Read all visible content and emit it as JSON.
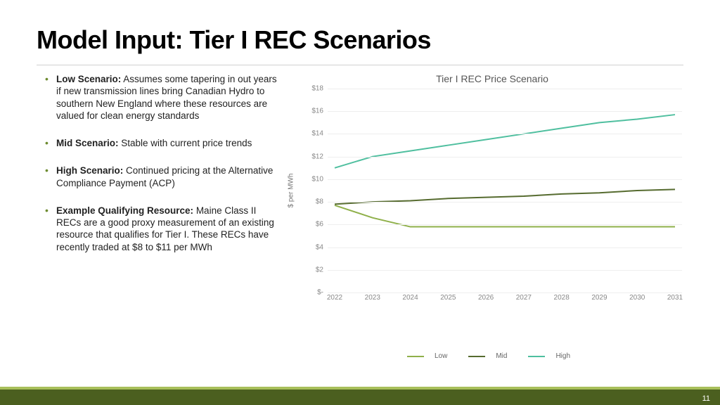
{
  "title": "Model Input: Tier I REC Scenarios",
  "bullets": [
    {
      "bold": "Low Scenario:",
      "rest": " Assumes some tapering in out years if new transmission lines bring Canadian Hydro to southern New England where these resources are valued for clean energy standards"
    },
    {
      "bold": "Mid Scenario:",
      "rest": " Stable with current price trends"
    },
    {
      "bold": "High Scenario:",
      "rest": " Continued pricing at the Alternative Compliance Payment (ACP)"
    },
    {
      "bold": "Example Qualifying Resource:",
      "rest": " Maine Class II RECs are a good proxy measurement of an existing resource that qualifies for Tier I. These RECs have recently traded at $8 to $11 per MWh"
    }
  ],
  "page_number": "11",
  "chart_data": {
    "type": "line",
    "title": "Tier I REC Price Scenario",
    "xlabel": "",
    "ylabel": "$ per MWh",
    "categories": [
      "2022",
      "2023",
      "2024",
      "2025",
      "2026",
      "2027",
      "2028",
      "2029",
      "2030",
      "2031"
    ],
    "yticks": [
      "$-",
      "$2",
      "$4",
      "$6",
      "$8",
      "$10",
      "$12",
      "$14",
      "$16",
      "$18"
    ],
    "ylim": [
      0,
      18
    ],
    "series": [
      {
        "name": "Low",
        "color": "#8fb04a",
        "values": [
          7.7,
          6.6,
          5.8,
          5.8,
          5.8,
          5.8,
          5.8,
          5.8,
          5.8,
          5.8
        ]
      },
      {
        "name": "Mid",
        "color": "#566b2f",
        "values": [
          7.8,
          8.0,
          8.1,
          8.3,
          8.4,
          8.5,
          8.7,
          8.8,
          9.0,
          9.1
        ]
      },
      {
        "name": "High",
        "color": "#4fbf9f",
        "values": [
          11.0,
          12.0,
          12.5,
          13.0,
          13.5,
          14.0,
          14.5,
          15.0,
          15.3,
          15.7
        ]
      }
    ],
    "legend_position": "bottom"
  }
}
